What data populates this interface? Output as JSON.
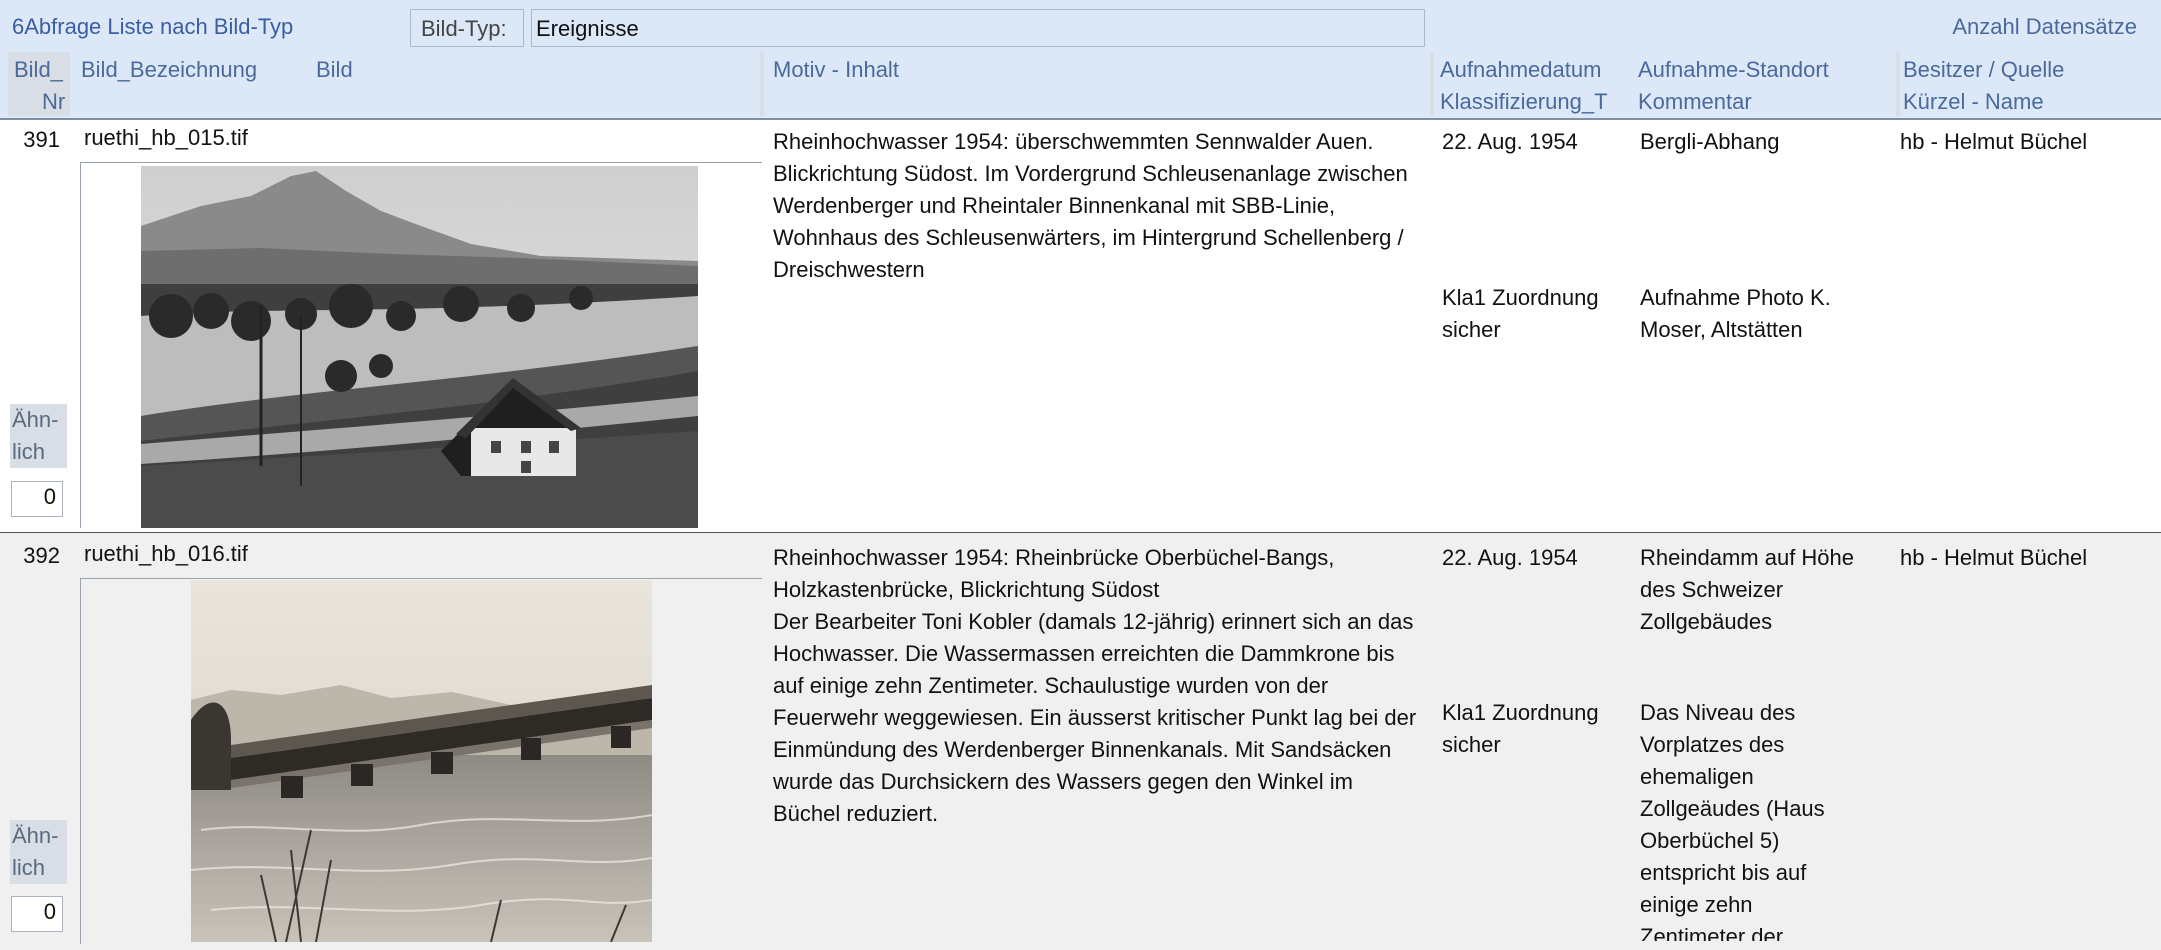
{
  "form": {
    "title": "6Abfrage Liste nach Bild-Typ",
    "type_label": "Bild-Typ:",
    "type_value": "Ereignisse",
    "count_label": "Anzahl Datensätze"
  },
  "columns": {
    "nr_line1": "Bild_",
    "nr_line2": "Nr",
    "bezeichnung": "Bild_Bezeichnung",
    "bild": "Bild",
    "motiv": "Motiv - Inhalt",
    "datum_line1": "Aufnahmedatum",
    "datum_line2": "Klassifizierung_T",
    "standort_line1": "Aufnahme-Standort",
    "standort_line2": "Kommentar",
    "besitzer_line1": "Besitzer / Quelle",
    "besitzer_line2": "Kürzel - Name"
  },
  "records": [
    {
      "nr": "391",
      "bezeichnung": "ruethi_hb_015.tif",
      "motiv": "Rheinhochwasser 1954: überschwemmten Sennwalder Auen. Blickrichtung Südost. Im Vordergrund Schleusenanlage zwischen Werdenberger und Rheintaler Binnenkanal mit SBB-Linie, Wohnhaus des Schleusenwärters, im Hintergrund Schellenberg / Dreischwestern",
      "datum": "22. Aug. 1954",
      "klassifizierung": "Kla1 Zuordnung sicher",
      "standort": "Bergli-Abhang",
      "kommentar": "Aufnahme Photo K. Moser, Altstätten",
      "besitzer": "hb - Helmut Büchel",
      "aehnlich_label": "Ähn-lich",
      "aehnlich_value": "0",
      "photo_icon": "flood-landscape-photo"
    },
    {
      "nr": "392",
      "bezeichnung": "ruethi_hb_016.tif",
      "motiv": "Rheinhochwasser 1954: Rheinbrücke Oberbüchel-Bangs, Holzkastenbrücke, Blickrichtung Südost\nDer Bearbeiter Toni Kobler (damals 12-jährig) erinnert sich an das Hochwasser. Die Wassermassen erreichten die Dammkrone bis auf einige zehn Zentimeter. Schaulustige wurden von der Feuerwehr weggewiesen. Ein äusserst kritischer Punkt lag bei der Einmündung des Werdenberger Binnenkanals. Mit Sandsäcken wurde das Durchsickern des Wassers gegen den Winkel im Büchel reduziert.",
      "datum": "22. Aug. 1954",
      "klassifizierung": "Kla1 Zuordnung sicher",
      "standort": "Rheindamm auf Höhe des Schweizer Zollgebäudes",
      "kommentar": "Das Niveau des Vorplatzes des ehemaligen Zollgeäudes (Haus Oberbüchel 5) entspricht bis auf einige zehn Zentimeter der",
      "besitzer": "hb - Helmut Büchel",
      "aehnlich_label": "Ähn-lich",
      "aehnlich_value": "0",
      "photo_icon": "covered-bridge-flood-photo"
    }
  ],
  "colors": {
    "header_band": "#dce8f8",
    "header_text": "#4a6a9c",
    "alt_row": "#f0f0f0"
  }
}
